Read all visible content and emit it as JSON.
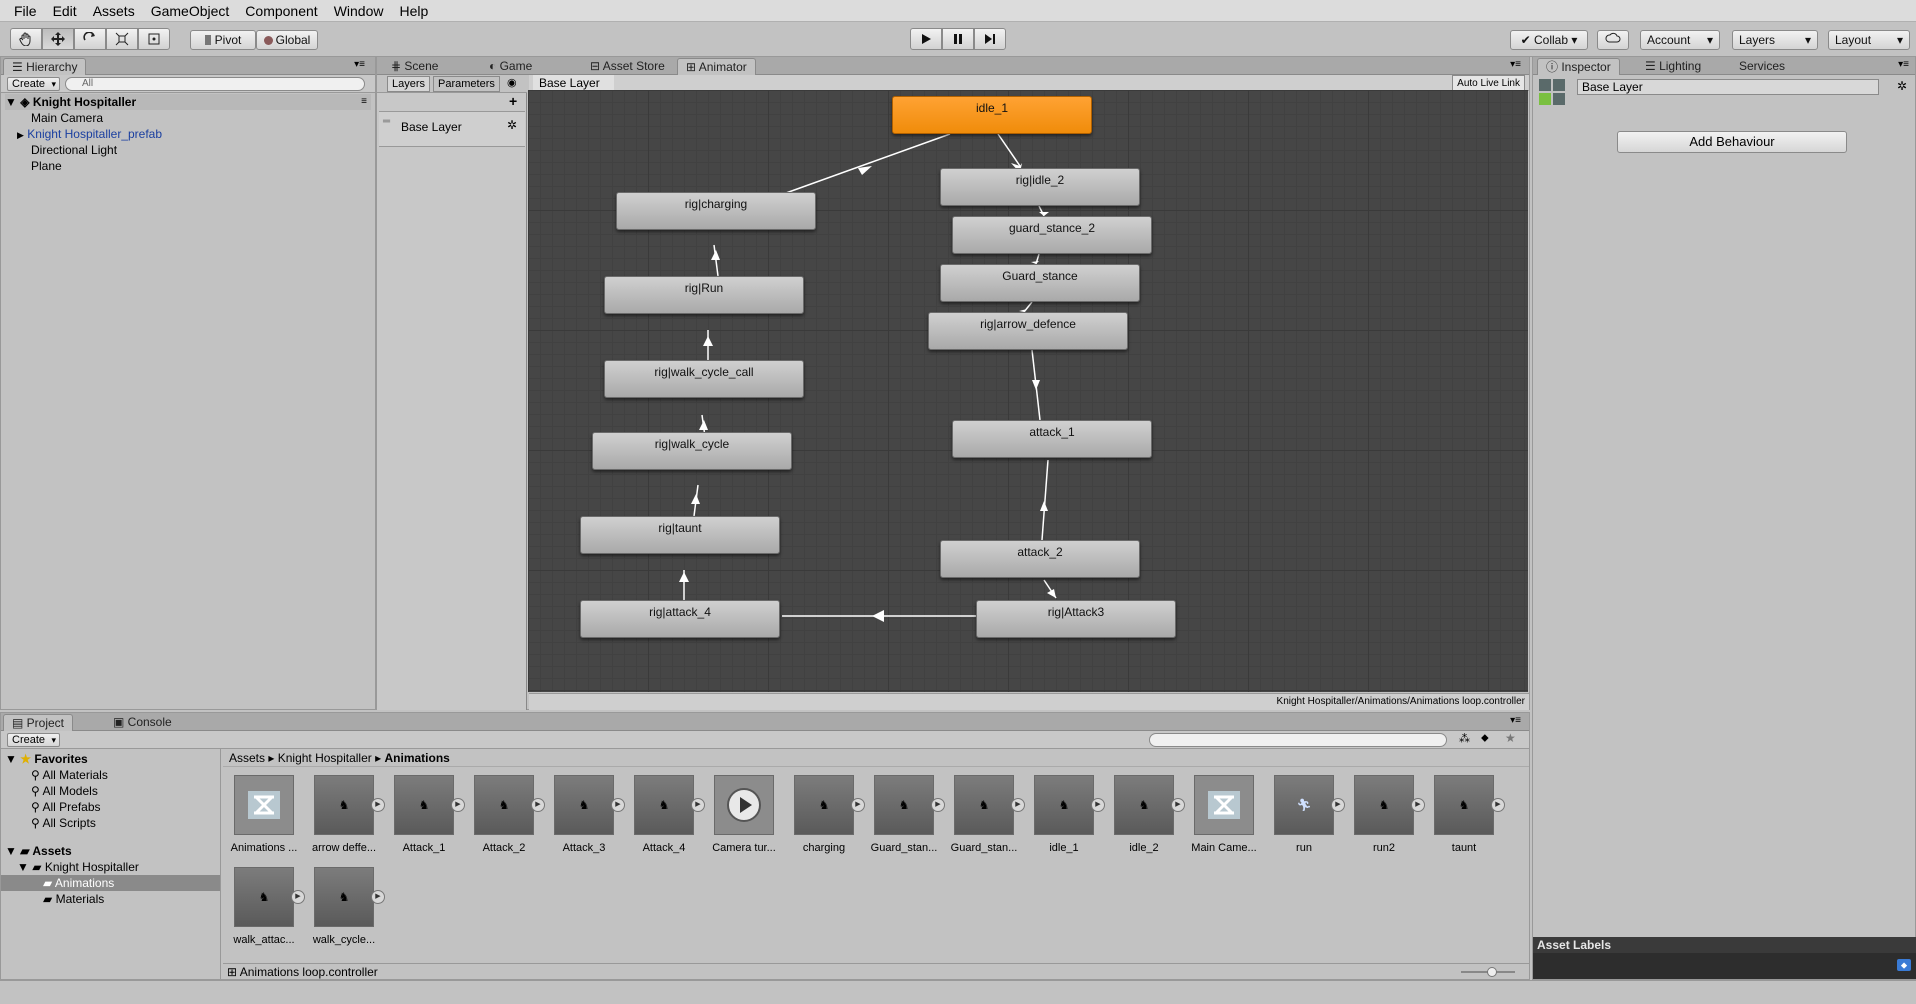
{
  "menubar": {
    "items": [
      "File",
      "Edit",
      "Assets",
      "GameObject",
      "Component",
      "Window",
      "Help"
    ]
  },
  "toolbar": {
    "pivot_label": "Pivot",
    "global_label": "Global",
    "collab_label": "Collab",
    "account_label": "Account",
    "layers_label": "Layers",
    "layout_label": "Layout"
  },
  "hierarchy": {
    "tab_label": "Hierarchy",
    "create_label": "Create",
    "search_placeholder": "All",
    "scene_name": "Knight Hospitaller",
    "items": [
      "Main Camera",
      "Knight Hospitaller_prefab",
      "Directional Light",
      "Plane"
    ]
  },
  "center_tabs": [
    "Scene",
    "Game",
    "Asset Store",
    "Animator"
  ],
  "animator": {
    "layers_tab": "Layers",
    "parameters_tab": "Parameters",
    "breadcrumb": "Base Layer",
    "auto_live_link": "Auto Live Link",
    "layer_name": "Base Layer",
    "footer_path": "Knight Hospitaller/Animations/Animations loop.controller",
    "states": [
      "idle_1",
      "rig|idle_2",
      "guard_stance_2",
      "Guard_stance",
      "rig|arrow_defence",
      "attack_1",
      "attack_2",
      "rig|Attack3",
      "rig|attack_4",
      "rig|taunt",
      "rig|walk_cycle",
      "rig|walk_cycle_call",
      "rig|Run",
      "rig|charging"
    ]
  },
  "inspector": {
    "tabs": [
      "Inspector",
      "Lighting",
      "Services"
    ],
    "title": "Base Layer",
    "add_behaviour": "Add Behaviour",
    "asset_labels": "Asset Labels"
  },
  "project": {
    "tabs": [
      "Project",
      "Console"
    ],
    "create_label": "Create",
    "favorites_label": "Favorites",
    "favorites": [
      "All Materials",
      "All Models",
      "All Prefabs",
      "All Scripts"
    ],
    "assets_label": "Assets",
    "folders": [
      "Knight Hospitaller",
      "Animations",
      "Materials"
    ],
    "breadcrumb": [
      "Assets",
      "Knight Hospitaller",
      "Animations"
    ],
    "assets": [
      "Animations ...",
      "arrow deffe...",
      "Attack_1",
      "Attack_2",
      "Attack_3",
      "Attack_4",
      "Camera tur...",
      "charging",
      "Guard_stan...",
      "Guard_stan...",
      "idle_1",
      "idle_2",
      "Main Came...",
      "run",
      "run2",
      "taunt",
      "walk_attac...",
      "walk_cycle..."
    ],
    "footer_file": "Animations loop.controller"
  },
  "colors": {
    "default_state": "#f39a1e",
    "graph_bg": "#464646",
    "panel_bg": "#c2c2c2"
  }
}
